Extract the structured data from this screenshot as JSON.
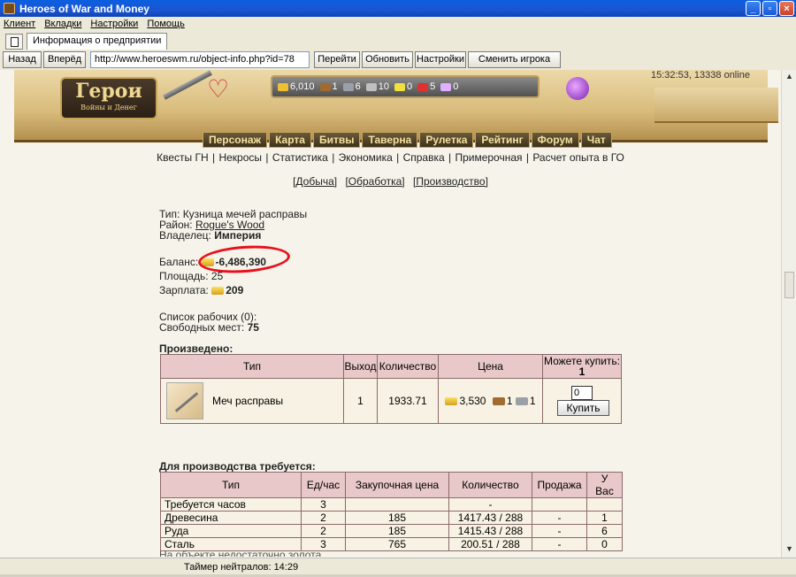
{
  "window": {
    "title": "Heroes of War and Money",
    "min": "_",
    "max": "▫",
    "close": "×"
  },
  "menu": [
    "Клиент",
    "Вкладки",
    "Настройки",
    "Помощь"
  ],
  "tab": {
    "label": "Информация о предприятии"
  },
  "nav": {
    "back": "Назад",
    "forward": "Вперёд",
    "url": "http://www.heroeswm.ru/object-info.php?id=78",
    "go": "Перейти",
    "refresh": "Обновить",
    "settings": "Настройки",
    "switch_player": "Сменить игрока"
  },
  "header": {
    "logo_big": "Герои",
    "logo_small": "Войны и Денег",
    "clock": "15:32:53, 13338 online",
    "resources": [
      {
        "icon": "gold-icon",
        "value": "6,010",
        "color": "#f0c030"
      },
      {
        "icon": "wood-icon",
        "value": "1",
        "color": "#a06a30"
      },
      {
        "icon": "ore-icon",
        "value": "6",
        "color": "#9aa0a8"
      },
      {
        "icon": "mercury-icon",
        "value": "10",
        "color": "#c0c0c0"
      },
      {
        "icon": "sulfur-icon",
        "value": "0",
        "color": "#f0e040"
      },
      {
        "icon": "crystal-icon",
        "value": "5",
        "color": "#e03030"
      },
      {
        "icon": "gems-icon",
        "value": "0",
        "color": "#e0b0ff"
      }
    ],
    "menu": [
      "Персонаж",
      "Карта",
      "Битвы",
      "Таверна",
      "Рулетка",
      "Рейтинг",
      "Форум",
      "Чат"
    ]
  },
  "sublinks": [
    "Квесты ГН",
    "Некросы",
    "Статистика",
    "Экономика",
    "Справка",
    "Примерочная",
    "Расчет опыта в ГО"
  ],
  "object_tabs": [
    "[Добыча]",
    "[Обработка]",
    "[Производство]"
  ],
  "info": {
    "type_label": "Тип:",
    "type_value": "Кузница мечей расправы",
    "district_label": "Район:",
    "district_value": "Rogue's Wood",
    "owner_label": "Владелец:",
    "owner_value": "Империя",
    "balance_label": "Баланс:",
    "balance_value": "-6,486,390",
    "area_label": "Площадь:",
    "area_value": "25",
    "salary_label": "Зарплата:",
    "salary_value": "209",
    "workers_label": "Список рабочих (0):",
    "free_label": "Свободных мест:",
    "free_value": "75"
  },
  "produced": {
    "title": "Произведено:",
    "headers": {
      "type": "Тип",
      "output": "Выход",
      "quantity": "Количество",
      "price": "Цена",
      "can_buy": "Можете купить:",
      "can_buy_value": "1"
    },
    "row": {
      "name": "Меч расправы",
      "output": "1",
      "quantity": "1933.71",
      "price_gold": "3,530",
      "price_wood": "1",
      "price_ore": "1",
      "qty_input": "0",
      "buy": "Купить"
    }
  },
  "required": {
    "title": "Для производства требуется:",
    "headers": [
      "Тип",
      "Ед/час",
      "Закупочная цена",
      "Количество",
      "Продажа",
      "У Вас"
    ],
    "rows": [
      [
        "Требуется часов",
        "3",
        "",
        "-",
        "",
        ""
      ],
      [
        "Древесина",
        "2",
        "185",
        "1417.43 / 288",
        "-",
        "1"
      ],
      [
        "Руда",
        "2",
        "185",
        "1415.43 / 288",
        "-",
        "6"
      ],
      [
        "Сталь",
        "3",
        "765",
        "200.51 / 288",
        "-",
        "0"
      ]
    ]
  },
  "note": "На объекте недостаточно золота",
  "status": {
    "timer": "Таймер нейтралов: 14:29"
  }
}
